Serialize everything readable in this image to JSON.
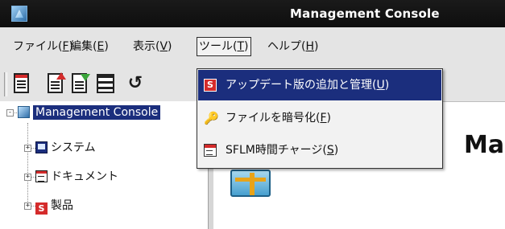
{
  "window": {
    "title": "Management Console",
    "icon": "console-app-icon"
  },
  "menubar": {
    "items": [
      {
        "label": "ファイル(",
        "mnemonic": "F",
        "suffix": ")"
      },
      {
        "label": "編集(",
        "mnemonic": "E",
        "suffix": ")"
      },
      {
        "label": "表示(",
        "mnemonic": "V",
        "suffix": ")"
      },
      {
        "label": "ツール(",
        "mnemonic": "T",
        "suffix": ")",
        "active": true
      },
      {
        "label": "ヘルプ(",
        "mnemonic": "H",
        "suffix": ")"
      }
    ]
  },
  "toolbar": {
    "buttons": [
      {
        "icon": "new-document-icon"
      },
      {
        "icon": "export-icon"
      },
      {
        "icon": "import-icon"
      },
      {
        "icon": "record-icon"
      },
      {
        "icon": "undo-icon"
      }
    ]
  },
  "tree": {
    "root": {
      "label": "Management Console",
      "icon": "console-icon",
      "selected": true,
      "expanded": true
    },
    "children": [
      {
        "label": "システム",
        "icon": "system-icon"
      },
      {
        "label": "ドキュメント",
        "icon": "document-icon"
      },
      {
        "label": "製品",
        "icon": "product-icon",
        "icon_glyph": "S"
      }
    ]
  },
  "content": {
    "heading": "Ma",
    "logo": "management-logo"
  },
  "tools_menu": {
    "items": [
      {
        "label": "アップデート版の追加と管理(",
        "mnemonic": "U",
        "suffix": ")",
        "icon": "update-icon",
        "icon_glyph": "S",
        "highlighted": true
      },
      {
        "label": "ファイルを暗号化(",
        "mnemonic": "F",
        "suffix": ")",
        "icon": "encrypt-key-icon",
        "icon_glyph": "🔑"
      },
      {
        "label": "SFLM時間チャージ(",
        "mnemonic": "S",
        "suffix": ")",
        "icon": "calendar-icon"
      }
    ]
  },
  "colors": {
    "selection": "#1b2e7d",
    "titlebar": "#1a1a1a",
    "accent_red": "#d42b2b"
  }
}
